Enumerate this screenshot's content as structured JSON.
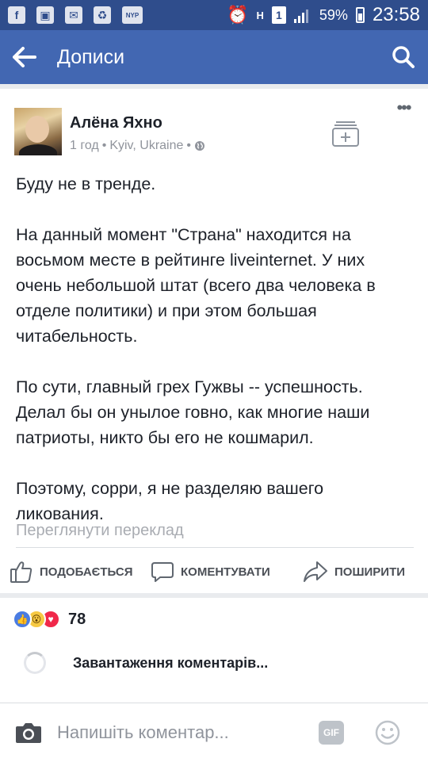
{
  "status_bar": {
    "battery": "59%",
    "time": "23:58",
    "sim": "1",
    "nyp": "NYP",
    "network": "H"
  },
  "app_bar": {
    "title": "Дописи"
  },
  "post": {
    "author": "Алёна Яхно",
    "time": "1 год",
    "location": "Kyiv, Ukraine",
    "separator": "•",
    "paragraphs": [
      "Буду не в тренде.",
      "На данный момент \"Страна\" находится на восьмом месте в рейтинге liveinternet. У них очень небольшой штат (всего два человека в отделе политики) и при этом большая читабельность.",
      "По сути, главный грех Гужвы -- успешность. Делал бы он унылое говно, как многие наши патриоты, никто бы его не кошмарил.",
      "Поэтому, сорри, я не разделяю вашего ликования."
    ],
    "translate_link": "Переглянути переклад"
  },
  "actions": {
    "like": "ПОДОБАЄТЬСЯ",
    "comment": "КОМЕНТУВАТИ",
    "share": "ПОШИРИТИ"
  },
  "reactions": {
    "count": "78"
  },
  "comments": {
    "loading": "Завантаження коментарів..."
  },
  "composer": {
    "placeholder": "Напишіть коментар...",
    "gif": "GIF"
  },
  "colors": {
    "status_bar": "#2f4d8c",
    "app_bar": "#4267b2",
    "text": "#1d2129",
    "muted": "#90949c"
  }
}
